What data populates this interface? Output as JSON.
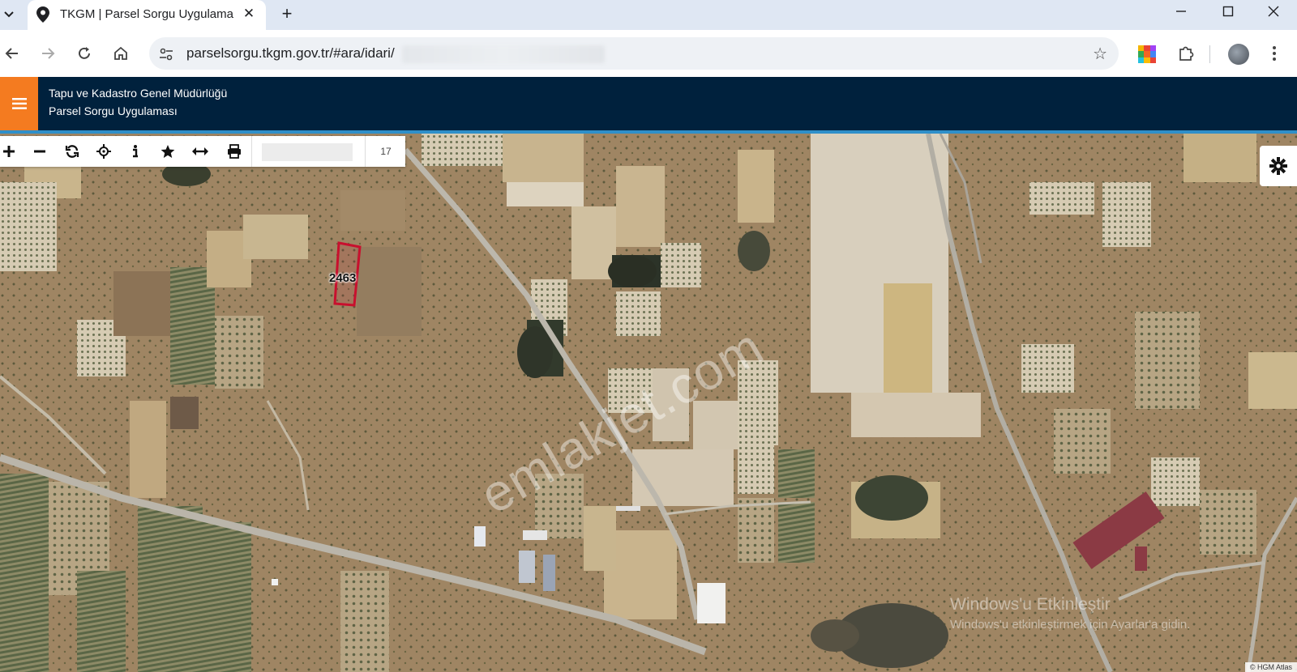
{
  "browser": {
    "tab_title": "TKGM | Parsel Sorgu Uygulaması",
    "url": "parselsorgu.tkgm.gov.tr/#ara/idari/",
    "icons": {
      "tab_dropdown": "chevron-down-icon",
      "tab_favicon": "map-pin-icon",
      "tab_close": "close-icon",
      "new_tab": "plus-icon",
      "minimize": "minimize-icon",
      "maximize": "maximize-icon",
      "close_window": "close-icon",
      "back": "arrow-left-icon",
      "forward": "arrow-right-icon",
      "reload": "reload-icon",
      "home": "home-icon",
      "site_info": "tune-icon",
      "bookmark": "star-icon",
      "extension": "puzzle-icon",
      "menu": "kebab-icon"
    }
  },
  "app": {
    "organization": "Tapu ve Kadastro Genel Müdürlüğü",
    "title": "Parsel Sorgu Uygulaması",
    "colors": {
      "header_bg": "#00213d",
      "menu_accent": "#f47b20",
      "parcel_outline": "#c8102e"
    }
  },
  "map": {
    "zoom_level": "17",
    "parcel_number": "2463",
    "watermark": "emlakjet.com",
    "windows_activation_title": "Windows'u Etkinleştir",
    "windows_activation_subtitle": "Windows'u etkinleştirmek için Ayarlar'a gidin.",
    "attribution": "© HGM Atlas",
    "tools": [
      "zoom-in-icon",
      "zoom-out-icon",
      "refresh-icon",
      "locate-icon",
      "info-icon",
      "star-icon",
      "measure-icon",
      "print-icon"
    ]
  }
}
